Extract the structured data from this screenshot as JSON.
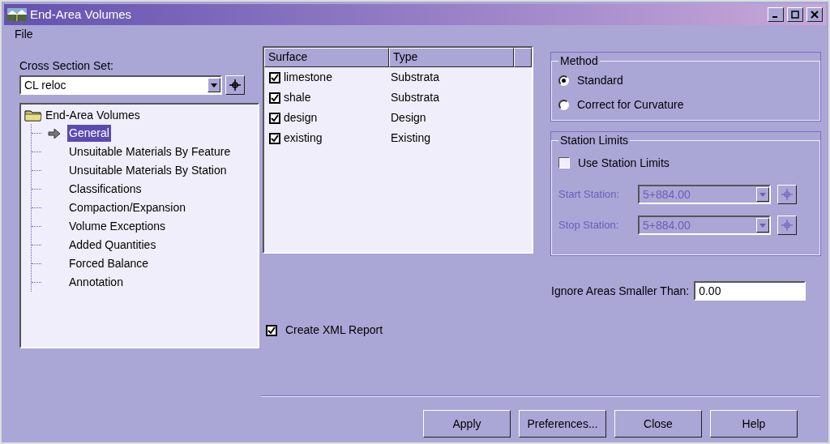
{
  "window": {
    "title": "End-Area Volumes"
  },
  "menu": [
    "File"
  ],
  "cross_section_set": {
    "label": "Cross Section Set:",
    "value": "CL reloc"
  },
  "tree": {
    "label": "End-Area Volumes",
    "children": [
      {
        "label": "General",
        "selected": true
      },
      {
        "label": "Unsuitable Materials By Feature",
        "selected": false
      },
      {
        "label": "Unsuitable Materials By Station",
        "selected": false
      },
      {
        "label": "Classifications",
        "selected": false
      },
      {
        "label": "Compaction/Expansion",
        "selected": false
      },
      {
        "label": "Volume Exceptions",
        "selected": false
      },
      {
        "label": "Added Quantities",
        "selected": false
      },
      {
        "label": "Forced Balance",
        "selected": false
      },
      {
        "label": "Annotation",
        "selected": false
      }
    ]
  },
  "surfaces": {
    "columns": [
      "Surface",
      "Type"
    ],
    "rows": [
      {
        "surface": "limestone",
        "type": "Substrata",
        "checked": true
      },
      {
        "surface": "shale",
        "type": "Substrata",
        "checked": true
      },
      {
        "surface": "design",
        "type": "Design",
        "checked": true
      },
      {
        "surface": "existing",
        "type": "Existing",
        "checked": true
      }
    ]
  },
  "create_xml_report": {
    "label": "Create XML Report",
    "checked": true
  },
  "method": {
    "title": "Method",
    "options": [
      {
        "label": "Standard",
        "selected": true
      },
      {
        "label": "Correct for Curvature",
        "selected": false
      }
    ]
  },
  "station_limits": {
    "title": "Station Limits",
    "use": {
      "label": "Use Station Limits",
      "checked": false
    },
    "fields": [
      {
        "label": "Start Station:",
        "value": "5+884.00",
        "disabled": true
      },
      {
        "label": "Stop Station:",
        "value": "5+884.00",
        "disabled": true
      }
    ]
  },
  "ignore_areas": {
    "label": "Ignore Areas Smaller Than:",
    "value": "0.00"
  },
  "buttons": [
    "Apply",
    "Preferences...",
    "Close",
    "Help"
  ]
}
